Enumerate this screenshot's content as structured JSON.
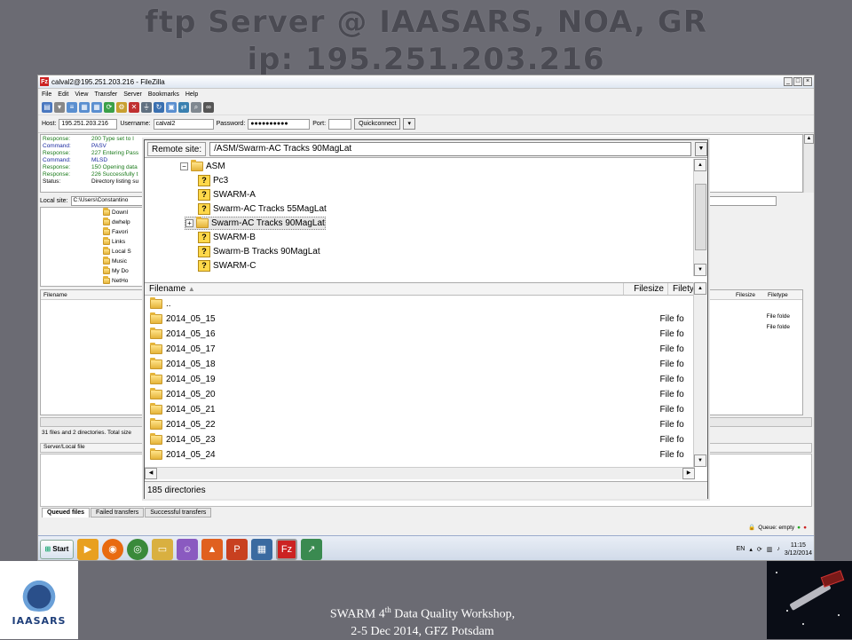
{
  "slide": {
    "title_line1": "ftp Server @ IAASARS, NOA, GR",
    "title_line2": "ip: 195.251.203.216"
  },
  "window": {
    "title": "calval2@195.251.203.216 - FileZilla",
    "menu": [
      "File",
      "Edit",
      "View",
      "Transfer",
      "Server",
      "Bookmarks",
      "Help"
    ]
  },
  "quickconnect": {
    "host_label": "Host:",
    "host_value": "195.251.203.216",
    "username_label": "Username:",
    "username_value": "calval2",
    "password_label": "Password:",
    "password_value": "●●●●●●●●●●",
    "port_label": "Port:",
    "port_value": "",
    "button": "Quickconnect"
  },
  "log": [
    {
      "k": "Response:",
      "v": "200 Type set to I"
    },
    {
      "k": "Command:",
      "v": "PASV"
    },
    {
      "k": "Response:",
      "v": "227 Entering Pass"
    },
    {
      "k": "Command:",
      "v": "MLSD"
    },
    {
      "k": "Response:",
      "v": "150 Opening data"
    },
    {
      "k": "Response:",
      "v": "226 Successfully t"
    },
    {
      "k": "Status:",
      "v": "Directory listing su"
    }
  ],
  "local": {
    "label": "Local site:",
    "path": "C:\\Users\\Constantino",
    "tree": [
      "Downl",
      "dwhelp",
      "Favori",
      "Links",
      "Local S",
      "Music",
      "My Do",
      "NetHo"
    ],
    "filename_header": "Filename",
    "filesize_header": "Filesize",
    "filetype_header": "Filetype",
    "right_types": [
      "File folde",
      "File folde"
    ],
    "status": "31 files and 2 directories. Total size",
    "server_local_header": "Server/Local file"
  },
  "queue": {
    "tabs": [
      "Queued files",
      "Failed transfers",
      "Successful transfers"
    ],
    "status": "Queue: empty"
  },
  "remote": {
    "label": "Remote site:",
    "path": "/ASM/Swarm-AC Tracks 90MagLat",
    "tree_root": "ASM",
    "tree_children": [
      "Pc3",
      "SWARM-A",
      "Swarm-AC Tracks 55MagLat",
      "Swarm-AC Tracks 90MagLat",
      "SWARM-B",
      "Swarm-B Tracks 90MagLat",
      "SWARM-C"
    ],
    "filename_header": "Filename",
    "filesize_header": "Filesize",
    "filetype_header": "Filety",
    "parent_dir": "..",
    "files": [
      "2014_05_15",
      "2014_05_16",
      "2014_05_17",
      "2014_05_18",
      "2014_05_19",
      "2014_05_20",
      "2014_05_21",
      "2014_05_22",
      "2014_05_23",
      "2014_05_24"
    ],
    "file_type": "File fo",
    "status": "185 directories"
  },
  "taskbar": {
    "start": "Start",
    "lang": "EN",
    "time": "11:15",
    "date": "3/12/2014"
  },
  "footer": {
    "logo_text": "IAASARS",
    "line1_pre": "SWARM 4",
    "line1_sup": "th",
    "line1_post": " Data Quality Workshop,",
    "line2": "2-5 Dec 2014, GFZ Potsdam"
  }
}
